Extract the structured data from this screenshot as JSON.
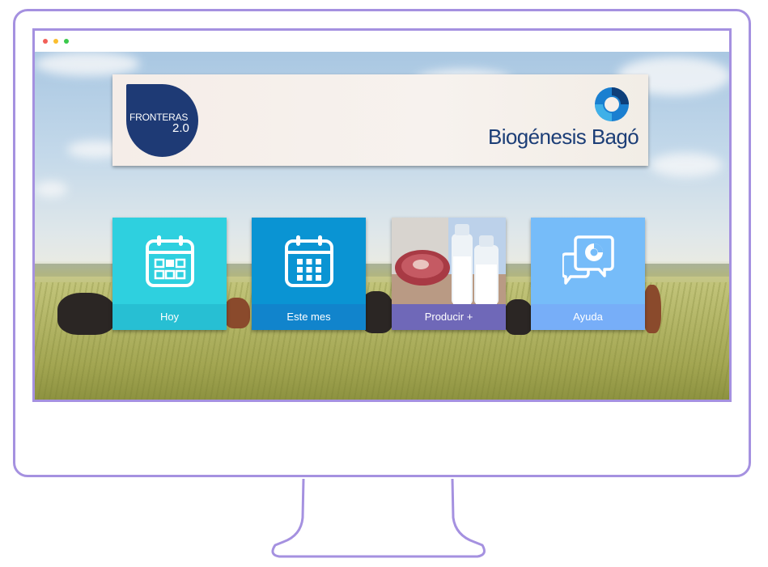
{
  "window": {
    "controls": [
      "close",
      "minimize",
      "maximize"
    ],
    "colors": {
      "close": "#f25f58",
      "minimize": "#fbbe2e",
      "maximize": "#3ac94b"
    }
  },
  "header": {
    "left_logo": {
      "line1": "FRONTERAS",
      "line2": "2.0",
      "color": "#1e3a75"
    },
    "right_logo": {
      "text": "Biogénesis Bagó",
      "color": "#1c3e77"
    }
  },
  "tiles": [
    {
      "label": "Hoy",
      "icon": "calendar-today-icon",
      "color": "#2ed0df"
    },
    {
      "label": "Este mes",
      "icon": "calendar-month-icon",
      "color": "#0a94d3"
    },
    {
      "label": "Producir +",
      "icon": "meat-milk-photo",
      "color": "#6f68b8"
    },
    {
      "label": "Ayuda",
      "icon": "chat-help-icon",
      "color": "#76bcf9"
    }
  ],
  "frame_color": "#a591e0"
}
